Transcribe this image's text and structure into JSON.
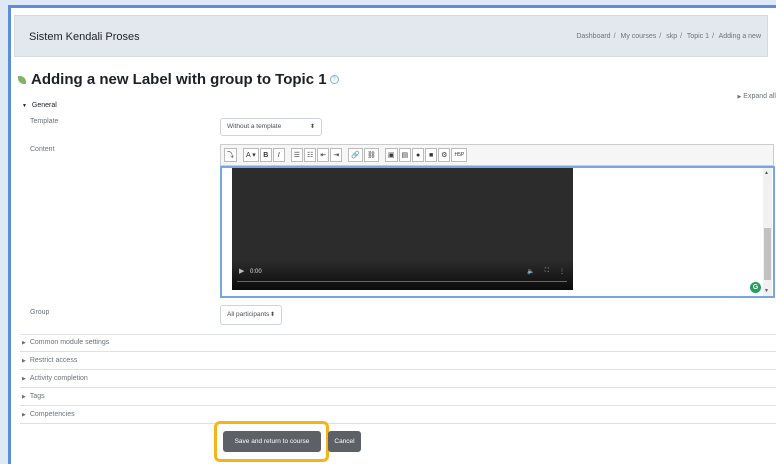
{
  "header": {
    "site_name": "Sistem Kendali Proses",
    "breadcrumbs": [
      "Dashboard",
      "My courses",
      "skp",
      "Topic 1",
      "Adding a new"
    ]
  },
  "page_title": "Adding a new Label with group to Topic 1",
  "expand_all": "Expand all",
  "general": {
    "legend": "General",
    "template_label": "Template",
    "template_value": "Without a template",
    "content_label": "Content",
    "group_label": "Group",
    "group_value": "All participants"
  },
  "video": {
    "time": "0:00"
  },
  "sections": [
    "Common module settings",
    "Restrict access",
    "Activity completion",
    "Tags",
    "Competencies"
  ],
  "buttons": {
    "save": "Save and return to course",
    "cancel": "Cancel"
  },
  "colors": {
    "accent_highlight": "#f3b415",
    "button": "#5d6166",
    "editor_border": "#76a8e0"
  }
}
